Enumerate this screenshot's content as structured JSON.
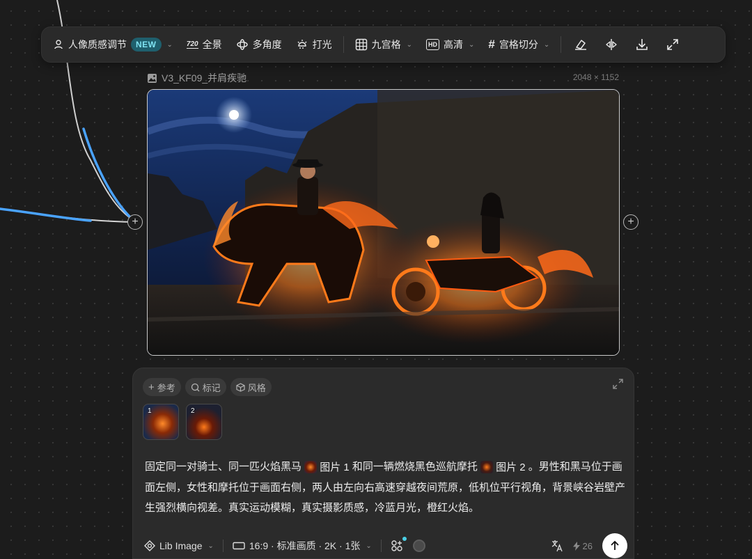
{
  "toolbar": {
    "portrait_label": "人像质感调节",
    "new_badge": "NEW",
    "panorama_label": "全景",
    "panorama_icon_text": "720",
    "multi_angle_label": "多角度",
    "lighting_label": "打光",
    "grid9_label": "九宫格",
    "hd_label": "高清",
    "hd_icon_text": "HD",
    "grid_split_label": "宫格切分"
  },
  "node": {
    "title": "V3_KF09_并肩疾驰",
    "dimensions": "2048 × 1152"
  },
  "panel": {
    "chips": {
      "reference": "参考",
      "mark": "标记",
      "style": "风格"
    },
    "thumbs": [
      {
        "num": "1"
      },
      {
        "num": "2"
      }
    ],
    "prompt": {
      "part1": "固定同一对骑士、同一匹火焰黑马",
      "ref1": "图片 1",
      "part2": "和同一辆燃烧黑色巡航摩托",
      "ref2": "图片 2",
      "part3": "。男性和黑马位于画面左侧，女性和摩托位于画面右侧，两人由左向右高速穿越夜间荒原，低机位平行视角，背景峡谷岩壁产生强烈横向视差。真实运动模糊，真实摄影质感，冷蓝月光，橙红火焰。"
    },
    "bottom": {
      "model": "Lib Image",
      "settings": "16:9 · 标准画质 · 2K · 1张",
      "credits": "26"
    }
  },
  "colors": {
    "accent_blue": "#4aa3ff",
    "new_badge_bg": "#1f5f6d",
    "new_badge_text": "#7fe3f2",
    "fire": "#ff6a1a"
  }
}
